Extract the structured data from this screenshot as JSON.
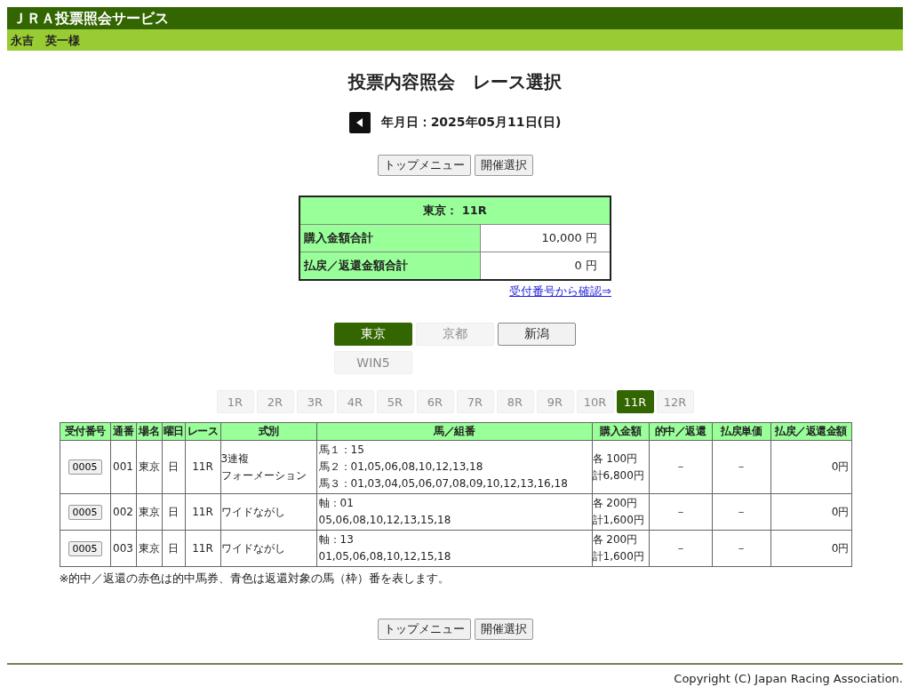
{
  "header": {
    "title": "ＪＲＡ投票照会サービス",
    "user": "永吉　英一様"
  },
  "page_title": "投票内容照会　レース選択",
  "date": {
    "label": "年月日：2025年05月11日(日)"
  },
  "nav_top": [
    "トップメニュー",
    "開催選択"
  ],
  "summary": {
    "heading": "東京： 11R",
    "rows": [
      {
        "label": "購入金額合計",
        "value": "10,000 円"
      },
      {
        "label": "払戻／返還金額合計",
        "value": "0 円"
      }
    ],
    "link": "受付番号から確認⇒"
  },
  "venues": [
    {
      "label": "東京",
      "selected": true,
      "disabled": false
    },
    {
      "label": "京都",
      "selected": false,
      "disabled": true
    },
    {
      "label": "新潟",
      "selected": false,
      "disabled": false
    },
    {
      "label": "WIN5",
      "selected": false,
      "disabled": true
    }
  ],
  "races": [
    {
      "label": "1R",
      "selected": false,
      "disabled": true
    },
    {
      "label": "2R",
      "selected": false,
      "disabled": true
    },
    {
      "label": "3R",
      "selected": false,
      "disabled": true
    },
    {
      "label": "4R",
      "selected": false,
      "disabled": true
    },
    {
      "label": "5R",
      "selected": false,
      "disabled": true
    },
    {
      "label": "6R",
      "selected": false,
      "disabled": true
    },
    {
      "label": "7R",
      "selected": false,
      "disabled": true
    },
    {
      "label": "8R",
      "selected": false,
      "disabled": true
    },
    {
      "label": "9R",
      "selected": false,
      "disabled": true
    },
    {
      "label": "10R",
      "selected": false,
      "disabled": true
    },
    {
      "label": "11R",
      "selected": true,
      "disabled": false
    },
    {
      "label": "12R",
      "selected": false,
      "disabled": true
    }
  ],
  "table": {
    "columns": [
      "受付番号",
      "通番",
      "場名",
      "曜日",
      "レース",
      "式別",
      "馬／組番",
      "購入金額",
      "的中／返還",
      "払戻単価",
      "払戻／返還金額"
    ],
    "rows": [
      {
        "receipt": "0005",
        "serial": "001",
        "venue": "東京",
        "day": "日",
        "race": "11R",
        "bet_type": [
          "3連複",
          "フォーメーション"
        ],
        "horses": [
          "馬１：15",
          "馬２：01,05,06,08,10,12,13,18",
          "馬３：01,03,04,05,06,07,08,09,10,12,13,16,18"
        ],
        "amount": [
          "各 100円",
          "計6,800円"
        ],
        "hit": "－",
        "unit_payout": "－",
        "payout": "0円"
      },
      {
        "receipt": "0005",
        "serial": "002",
        "venue": "東京",
        "day": "日",
        "race": "11R",
        "bet_type": [
          "ワイドながし"
        ],
        "horses": [
          "軸：01",
          "05,06,08,10,12,13,15,18"
        ],
        "amount": [
          "各 200円",
          "計1,600円"
        ],
        "hit": "－",
        "unit_payout": "－",
        "payout": "0円"
      },
      {
        "receipt": "0005",
        "serial": "003",
        "venue": "東京",
        "day": "日",
        "race": "11R",
        "bet_type": [
          "ワイドながし"
        ],
        "horses": [
          "軸：13",
          "01,05,06,08,10,12,15,18"
        ],
        "amount": [
          "各 200円",
          "計1,600円"
        ],
        "hit": "－",
        "unit_payout": "－",
        "payout": "0円"
      }
    ],
    "note": "※的中／返還の赤色は的中馬券、青色は返還対象の馬（枠）番を表します。"
  },
  "nav_bottom": [
    "トップメニュー",
    "開催選択"
  ],
  "footer": {
    "copyright": "Copyright (C) Japan Racing Association."
  }
}
